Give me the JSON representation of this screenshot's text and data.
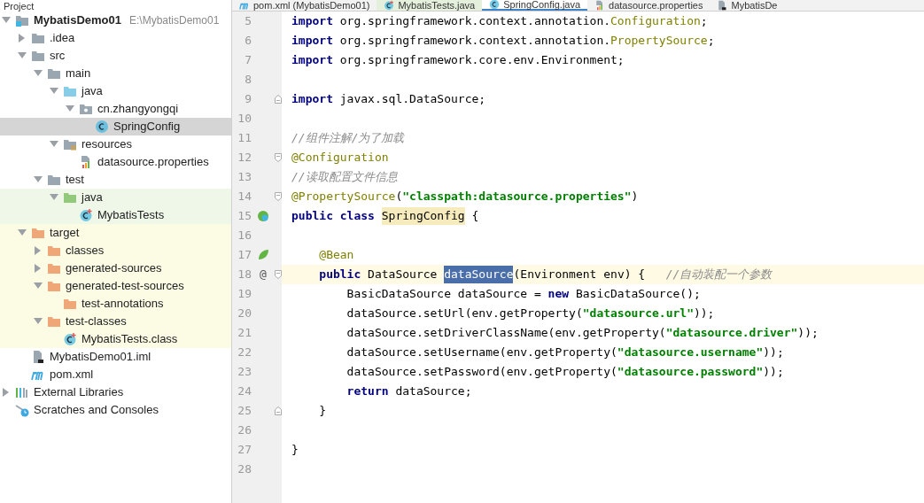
{
  "project_panel": {
    "title": "Project",
    "tree": [
      {
        "label": "MybatisDemo01",
        "path": "E:\\MybatisDemo01",
        "kind": "module",
        "expanded": true,
        "selected": false,
        "children": [
          {
            "label": ".idea",
            "kind": "folder",
            "expanded": false,
            "selected": false
          },
          {
            "label": "src",
            "kind": "folder",
            "expanded": true,
            "selected": false,
            "children": [
              {
                "label": "main",
                "kind": "folder",
                "expanded": true,
                "selected": false,
                "children": [
                  {
                    "label": "java",
                    "kind": "source-folder",
                    "expanded": true,
                    "selected": false,
                    "children": [
                      {
                        "label": "cn.zhangyongqi",
                        "kind": "package",
                        "expanded": true,
                        "selected": false,
                        "children": [
                          {
                            "label": "SpringConfig",
                            "kind": "class",
                            "selected": true
                          }
                        ]
                      }
                    ]
                  },
                  {
                    "label": "resources",
                    "kind": "resources-folder",
                    "expanded": true,
                    "selected": false,
                    "children": [
                      {
                        "label": "datasource.properties",
                        "kind": "properties",
                        "selected": false
                      }
                    ]
                  }
                ]
              },
              {
                "label": "test",
                "kind": "folder",
                "expanded": true,
                "selected": false,
                "children": [
                  {
                    "label": "java",
                    "kind": "test-folder",
                    "expanded": true,
                    "selected": false,
                    "test_source": true,
                    "children": [
                      {
                        "label": "MybatisTests",
                        "kind": "test-class",
                        "selected": false,
                        "test_source": true
                      }
                    ]
                  }
                ]
              }
            ]
          },
          {
            "label": "target",
            "kind": "excluded-folder",
            "expanded": true,
            "selected": false,
            "excluded": true,
            "children": [
              {
                "label": "classes",
                "kind": "excluded-folder",
                "expanded": false,
                "selected": false,
                "excluded": true
              },
              {
                "label": "generated-sources",
                "kind": "excluded-folder",
                "expanded": false,
                "selected": false,
                "excluded": true
              },
              {
                "label": "generated-test-sources",
                "kind": "excluded-folder",
                "expanded": true,
                "selected": false,
                "excluded": true,
                "children": [
                  {
                    "label": "test-annotations",
                    "kind": "excluded-folder",
                    "selected": false,
                    "excluded": true
                  }
                ]
              },
              {
                "label": "test-classes",
                "kind": "excluded-folder",
                "expanded": true,
                "selected": false,
                "excluded": true,
                "children": [
                  {
                    "label": "MybatisTests.class",
                    "kind": "test-class",
                    "selected": false,
                    "excluded": true
                  }
                ]
              }
            ]
          },
          {
            "label": "MybatisDemo01.iml",
            "kind": "module-file",
            "selected": false
          },
          {
            "label": "pom.xml",
            "kind": "maven",
            "selected": false
          }
        ]
      },
      {
        "label": "External Libraries",
        "kind": "libraries",
        "expanded": false,
        "selected": false
      },
      {
        "label": "Scratches and Consoles",
        "kind": "scratches",
        "selected": false
      }
    ]
  },
  "tabs": [
    {
      "label": "pom.xml (MybatisDemo01)",
      "kind": "maven",
      "selected": false
    },
    {
      "label": "MybatisTests.java",
      "kind": "test-class",
      "selected": false
    },
    {
      "label": "SpringConfig.java",
      "kind": "class",
      "selected": true
    },
    {
      "label": "datasource.properties",
      "kind": "properties",
      "selected": false
    },
    {
      "label": "MybatisDe",
      "kind": "module-file",
      "selected": false
    }
  ],
  "editor": {
    "lines": [
      {
        "number": "5",
        "tokens": [
          {
            "kind": "keyword",
            "text": "import"
          },
          {
            "kind": "plain",
            "text": " org.springframework.context.annotation."
          },
          {
            "kind": "annotation",
            "text": "Configuration"
          },
          {
            "kind": "plain",
            "text": ";"
          }
        ]
      },
      {
        "number": "6",
        "tokens": [
          {
            "kind": "keyword",
            "text": "import"
          },
          {
            "kind": "plain",
            "text": " org.springframework.context.annotation."
          },
          {
            "kind": "annotation",
            "text": "PropertySource"
          },
          {
            "kind": "plain",
            "text": ";"
          }
        ]
      },
      {
        "number": "7",
        "tokens": [
          {
            "kind": "keyword",
            "text": "import"
          },
          {
            "kind": "plain",
            "text": " org.springframework.core.env.Environment;"
          }
        ]
      },
      {
        "number": "8"
      },
      {
        "number": "9",
        "fold_end": true,
        "tokens": [
          {
            "kind": "keyword",
            "text": "import"
          },
          {
            "kind": "plain",
            "text": " javax.sql.DataSource;"
          }
        ]
      },
      {
        "number": "10"
      },
      {
        "number": "11",
        "tokens": [
          {
            "kind": "comment",
            "text": "//组件注解/为了加载"
          }
        ]
      },
      {
        "number": "12",
        "fold_start": true,
        "tokens": [
          {
            "kind": "annotation",
            "text": "@Configuration"
          }
        ]
      },
      {
        "number": "13",
        "tokens": [
          {
            "kind": "comment",
            "text": "//读取配置文件信息"
          }
        ]
      },
      {
        "number": "14",
        "fold_start": true,
        "tokens": [
          {
            "kind": "annotation",
            "text": "@PropertySource"
          },
          {
            "kind": "plain",
            "text": "("
          },
          {
            "kind": "string",
            "text": "\"classpath:datasource.properties\""
          },
          {
            "kind": "plain",
            "text": ")"
          }
        ]
      },
      {
        "number": "15",
        "implemented_marker": true,
        "tokens": [
          {
            "kind": "keyword",
            "text": "public class "
          },
          {
            "kind": "highlight",
            "text": "SpringConfig"
          },
          {
            "kind": "plain",
            "text": " {"
          }
        ]
      },
      {
        "number": "16"
      },
      {
        "number": "17",
        "bean_marker": true,
        "tokens": [
          {
            "kind": "annotation",
            "text": "    @Bean"
          }
        ]
      },
      {
        "number": "18",
        "marker_text": "@",
        "fold_start": true,
        "current": true,
        "tokens": [
          {
            "kind": "keyword",
            "text": "    public"
          },
          {
            "kind": "plain",
            "text": " DataSource "
          },
          {
            "kind": "selection",
            "text": "dataSource"
          },
          {
            "kind": "plain",
            "text": "(Environment env) {   "
          },
          {
            "kind": "comment",
            "text": "//自动装配一个参数"
          }
        ]
      },
      {
        "number": "19",
        "tokens": [
          {
            "kind": "plain",
            "text": "        BasicDataSource dataSource = "
          },
          {
            "kind": "keyword",
            "text": "new"
          },
          {
            "kind": "plain",
            "text": " BasicDataSource();"
          }
        ]
      },
      {
        "number": "20",
        "tokens": [
          {
            "kind": "plain",
            "text": "        dataSource.setUrl(env.getProperty("
          },
          {
            "kind": "string",
            "text": "\"datasource.url\""
          },
          {
            "kind": "plain",
            "text": "));"
          }
        ]
      },
      {
        "number": "21",
        "tokens": [
          {
            "kind": "plain",
            "text": "        dataSource.setDriverClassName(env.getProperty("
          },
          {
            "kind": "string",
            "text": "\"datasource.driver\""
          },
          {
            "kind": "plain",
            "text": "));"
          }
        ]
      },
      {
        "number": "22",
        "tokens": [
          {
            "kind": "plain",
            "text": "        dataSource.setUsername(env.getProperty("
          },
          {
            "kind": "string",
            "text": "\"datasource.username\""
          },
          {
            "kind": "plain",
            "text": "));"
          }
        ]
      },
      {
        "number": "23",
        "tokens": [
          {
            "kind": "plain",
            "text": "        dataSource.setPassword(env.getProperty("
          },
          {
            "kind": "string",
            "text": "\"datasource.password\""
          },
          {
            "kind": "plain",
            "text": "));"
          }
        ]
      },
      {
        "number": "24",
        "tokens": [
          {
            "kind": "keyword",
            "text": "        return"
          },
          {
            "kind": "plain",
            "text": " dataSource;"
          }
        ]
      },
      {
        "number": "25",
        "fold_end": true,
        "tokens": [
          {
            "kind": "plain",
            "text": "    }"
          }
        ]
      },
      {
        "number": "26"
      },
      {
        "number": "27",
        "tokens": [
          {
            "kind": "plain",
            "text": "}"
          }
        ]
      },
      {
        "number": "28"
      }
    ]
  }
}
